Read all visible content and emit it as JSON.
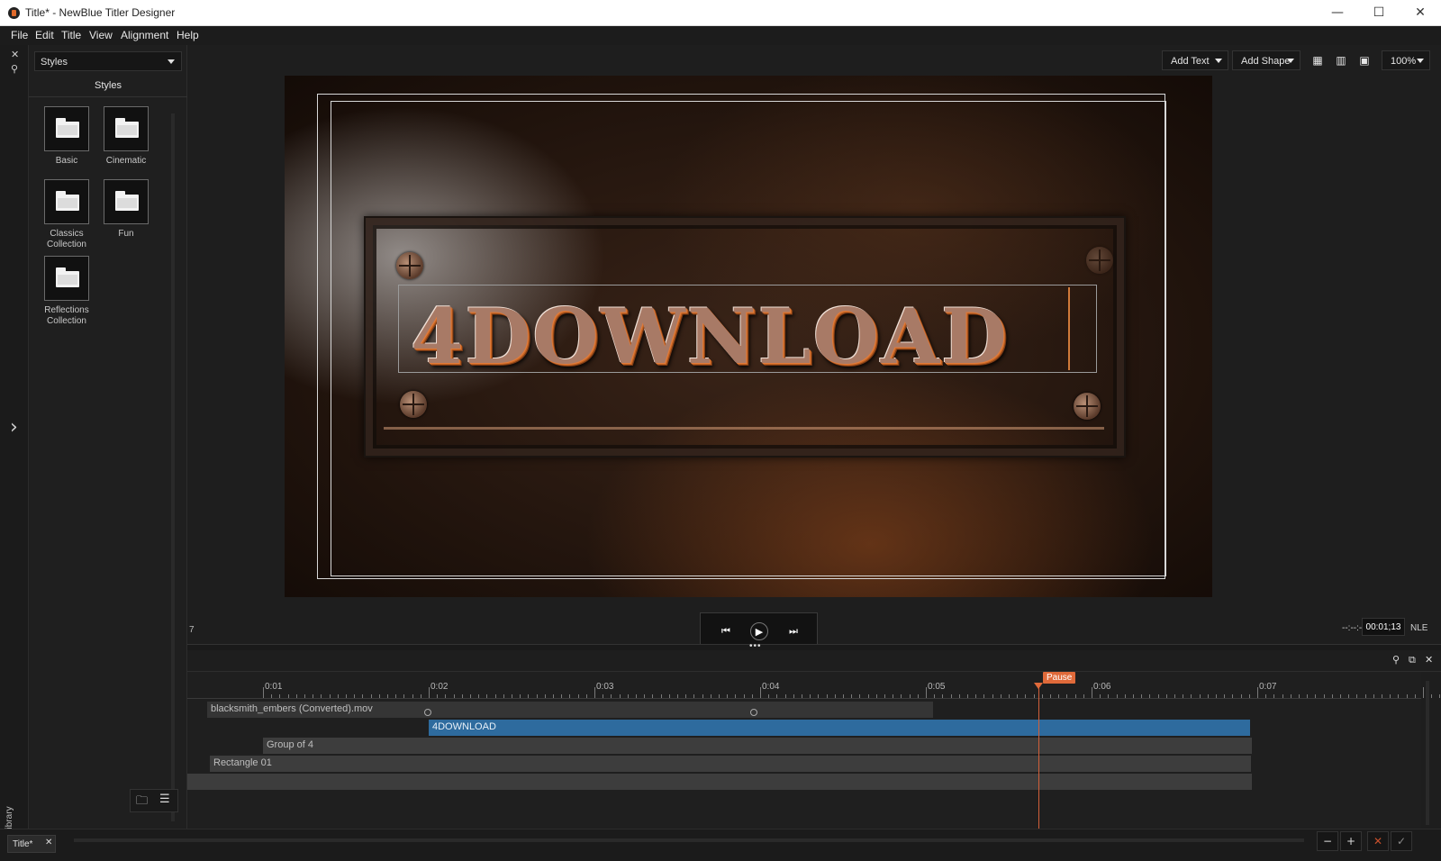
{
  "window": {
    "title": "Title* - NewBlue Titler Designer",
    "minimize": "—",
    "maximize": "☐",
    "close": "✕"
  },
  "menu": [
    "File",
    "Edit",
    "Title",
    "View",
    "Alignment",
    "Help"
  ],
  "left_strip": {
    "close_glyph": "✕",
    "pin_glyph": "⚲",
    "expand_glyph": "›",
    "library_label": "Library"
  },
  "library": {
    "dropdown_value": "Styles",
    "heading": "Styles",
    "items": [
      {
        "label": "Basic"
      },
      {
        "label": "Cinematic"
      },
      {
        "label": "Classics Collection"
      },
      {
        "label": "Fun"
      },
      {
        "label": "Reflections Collection"
      }
    ],
    "new_folder_glyph": "🗀",
    "list_view_glyph": "☰"
  },
  "toolbar": {
    "add_text": "Add Text",
    "add_shape": "Add Shape",
    "grid_glyph": "▦",
    "ruler_glyph": "▥",
    "safe_glyph": "▣",
    "zoom": "100%"
  },
  "canvas": {
    "text": "4DOWNLOAD",
    "accent": "#e07a3a"
  },
  "transport": {
    "prev_glyph": "⏮",
    "play_glyph": "▶",
    "next_glyph": "⏭",
    "left_marker": "7",
    "timecode_blank": "--:--:--",
    "timecode": "00:01;13",
    "mode": "NLE"
  },
  "timeline": {
    "handle": "•••",
    "pin_glyph": "⚲",
    "float_glyph": "⧉",
    "close_glyph": "✕",
    "ruler_labels": [
      "0:01",
      "0:02",
      "0:03",
      "0:04",
      "0:05",
      "0:06",
      "0:07"
    ],
    "playhead_label": "Pause",
    "tracks": [
      {
        "name": "blacksmith_embers (Converted).mov"
      },
      {
        "name": "4DOWNLOAD"
      },
      {
        "name": "Group of 4"
      },
      {
        "name": "Rectangle 01"
      },
      {
        "name": ""
      }
    ],
    "selected_color": "#2e6b9e",
    "playhead_color": "#d2603a"
  },
  "bottombar": {
    "tab_label": "Title*",
    "tab_close": "✕",
    "zoom_out": "−",
    "zoom_in": "+",
    "cancel": "✕",
    "confirm": "✓",
    "cancel_color": "#c8502c"
  }
}
